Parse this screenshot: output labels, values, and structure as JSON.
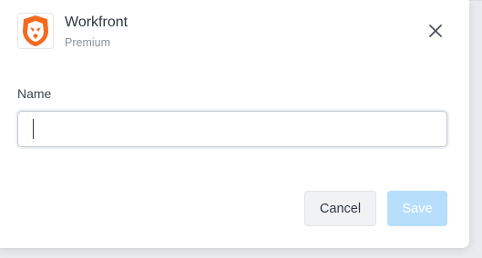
{
  "app": {
    "name": "Workfront",
    "plan": "Premium",
    "logo_icon": "lion-shield-icon",
    "brand_color": "#f36b21"
  },
  "form": {
    "name_label": "Name",
    "name_value": "",
    "name_placeholder": ""
  },
  "actions": {
    "cancel_label": "Cancel",
    "save_label": "Save",
    "save_disabled": true,
    "save_color": "#b6dffc"
  },
  "close_icon": "close-icon"
}
